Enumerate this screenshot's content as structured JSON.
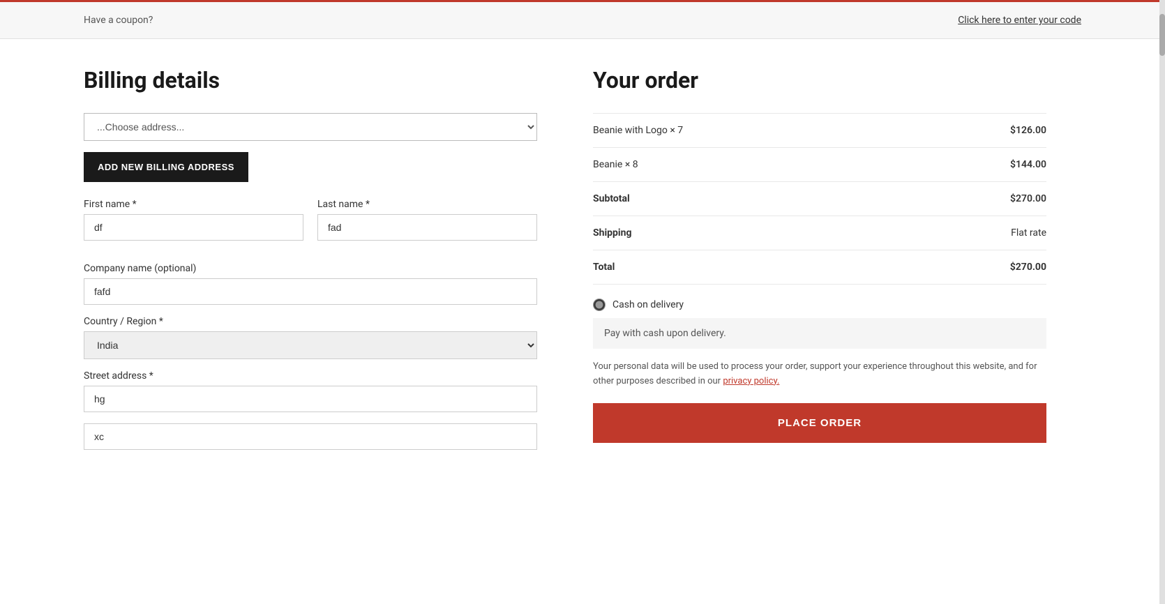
{
  "topbar": {
    "coupon_text": "Have a coupon?",
    "coupon_link": "Click here to enter your code"
  },
  "billing": {
    "title": "Billing details",
    "address_select": {
      "placeholder": "...Choose address...",
      "options": [
        "...Choose address..."
      ]
    },
    "add_address_btn": "ADD NEW BILLING ADDRESS",
    "fields": {
      "first_name_label": "First name *",
      "first_name_value": "df",
      "last_name_label": "Last name *",
      "last_name_value": "fad",
      "company_label": "Company name (optional)",
      "company_value": "fafd",
      "country_label": "Country / Region *",
      "country_value": "India",
      "street_label": "Street address *",
      "street_value": "hg",
      "street2_value": "xc"
    }
  },
  "order": {
    "title": "Your order",
    "items": [
      {
        "name": "Beanie with Logo",
        "quantity": "× 7",
        "price": "$126.00"
      },
      {
        "name": "Beanie",
        "quantity": "× 8",
        "price": "$144.00"
      }
    ],
    "subtotal_label": "Subtotal",
    "subtotal_value": "$270.00",
    "shipping_label": "Shipping",
    "shipping_value": "Flat rate",
    "total_label": "Total",
    "total_value": "$270.00",
    "payment": {
      "option_label": "Cash on delivery",
      "description": "Pay with cash upon delivery."
    },
    "privacy_notice": "Your personal data will be used to process your order, support your experience throughout this website, and for other purposes described in our ",
    "privacy_link": "privacy policy.",
    "place_order_btn": "PLACE ORDER"
  }
}
